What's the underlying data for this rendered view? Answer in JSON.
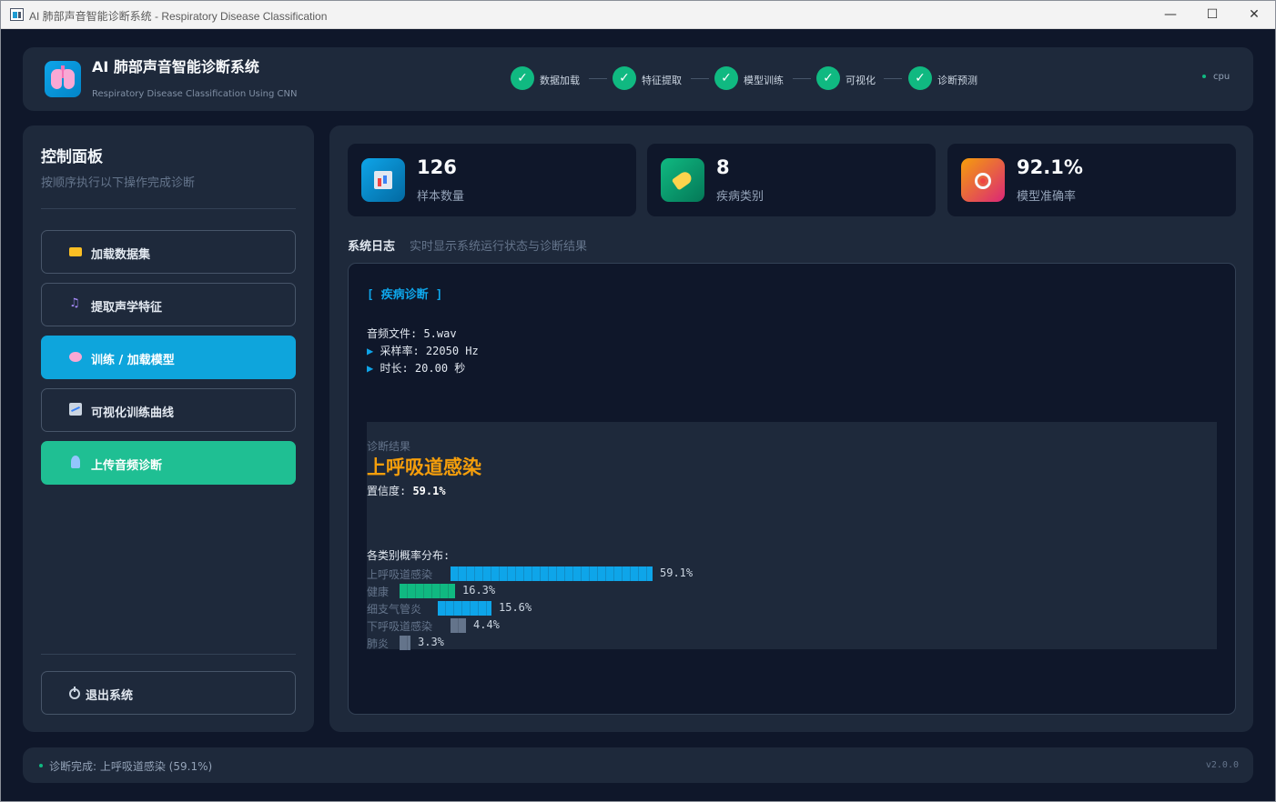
{
  "window": {
    "title": "AI 肺部声音智能诊断系统 - Respiratory Disease Classification",
    "min_glyph": "—",
    "max_glyph": "☐",
    "close_glyph": "✕"
  },
  "header": {
    "title": "AI 肺部声音智能诊断系统",
    "subtitle": "Respiratory Disease Classification Using CNN",
    "device": "cpu",
    "steps": [
      {
        "label": "数据加载",
        "done": true
      },
      {
        "label": "特征提取",
        "done": true
      },
      {
        "label": "模型训练",
        "done": true
      },
      {
        "label": "可视化",
        "done": true
      },
      {
        "label": "诊断预测",
        "done": true
      }
    ],
    "check_glyph": "✓",
    "logo_icon": "lungs-icon"
  },
  "sidebar": {
    "title": "控制面板",
    "subtitle": "按顺序执行以下操作完成诊断",
    "buttons": [
      {
        "label": "加载数据集",
        "icon": "folder-icon"
      },
      {
        "label": "提取声学特征",
        "icon": "music-note-icon"
      },
      {
        "label": "训练 / 加载模型",
        "icon": "brain-icon"
      },
      {
        "label": "可视化训练曲线",
        "icon": "chart-icon"
      },
      {
        "label": "上传音频诊断",
        "icon": "microscope-icon"
      }
    ],
    "exit_label": "退出系统",
    "exit_icon": "power-icon"
  },
  "stats": [
    {
      "value": "126",
      "caption": "样本数量",
      "icon": "bar-chart-icon"
    },
    {
      "value": "8",
      "caption": "疾病类别",
      "icon": "tag-icon"
    },
    {
      "value": "92.1%",
      "caption": "模型准确率",
      "icon": "target-icon"
    }
  ],
  "log": {
    "title": "系统日志",
    "subtitle": "实时显示系统运行状态与诊断结果",
    "section": "[ 疾病诊断 ]",
    "file_line": "音频文件: 5.wav",
    "bullet": "▶",
    "sample_rate_line": "采样率: 22050 Hz",
    "duration_line": "时长: 20.00 秒",
    "result": {
      "caption": "诊断结果",
      "disease": "上呼吸道感染",
      "confidence_label": "置信度: ",
      "confidence_value": "59.1%"
    },
    "distribution_caption": "各类别概率分布:"
  },
  "chart_data": {
    "type": "bar",
    "categories": [
      "上呼吸道感染",
      "健康",
      "细支气管炎",
      "下呼吸道感染",
      "肺炎"
    ],
    "values": [
      59.1,
      16.3,
      15.6,
      4.4,
      3.3
    ],
    "labels": [
      "59.1%",
      "16.3%",
      "15.6%",
      "4.4%",
      "3.3%"
    ],
    "colors": [
      "#0ea5e9",
      "#10b981",
      "#0ea5e9",
      "#64748b",
      "#64748b"
    ],
    "orientation": "horizontal"
  },
  "status": {
    "text": "诊断完成: 上呼吸道感染 (59.1%)",
    "version": "v2.0.0"
  }
}
